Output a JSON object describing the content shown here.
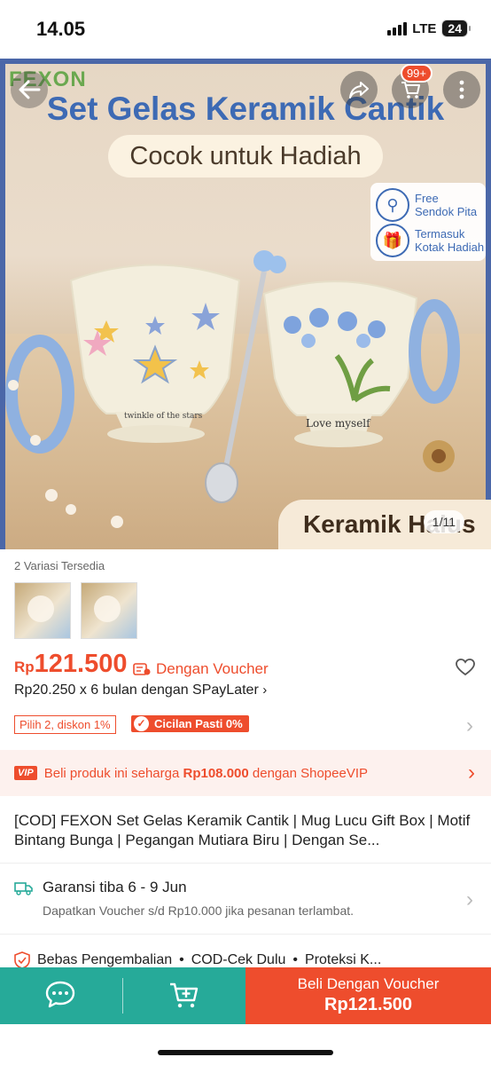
{
  "status_bar": {
    "time": "14.05",
    "network": "LTE",
    "battery": "24"
  },
  "hero": {
    "brand": "FEXON",
    "title": "Set Gelas Keramik Cantik",
    "subtitle": "Cocok untuk Hadiah",
    "badge1": "Free\nSendok Pita",
    "badge2": "Termasuk\nKotak Hadiah",
    "mug1_text": "twinkle of the stars",
    "mug2_text": "Love myself",
    "bottom_label": "Keramik Halus",
    "counter": "1/11",
    "cart_badge": "99+"
  },
  "variants": {
    "label": "2 Variasi Tersedia",
    "count": 2
  },
  "price": {
    "currency": "Rp",
    "value": "121.500",
    "voucher_label": "Dengan Voucher",
    "installment": "Rp20.250 x 6 bulan dengan SPayLater",
    "tag_discount": "Pilih 2, diskon 1%",
    "tag_installment": "Cicilan Pasti 0%"
  },
  "vip": {
    "badge": "VIP",
    "prefix": "Beli produk ini seharga ",
    "amount": "Rp108.000",
    "suffix": " dengan ShopeeVIP"
  },
  "product_title": "[COD] FEXON Set Gelas Keramik Cantik | Mug Lucu Gift Box | Motif Bintang Bunga | Pegangan Mutiara Biru | Dengan Se...",
  "shipping": {
    "line1": "Garansi tiba 6 - 9 Jun",
    "line2": "Dapatkan Voucher s/d Rp10.000 jika pesanan terlambat."
  },
  "guarantees": [
    "Bebas Pengembalian",
    "COD-Cek Dulu",
    "Proteksi K..."
  ],
  "bottom_bar": {
    "buy_label": "Beli Dengan Voucher",
    "buy_price": "Rp121.500"
  },
  "colors": {
    "accent": "#ee4d2d",
    "teal": "#26aa99",
    "hero_blue": "#3d6ab4"
  }
}
